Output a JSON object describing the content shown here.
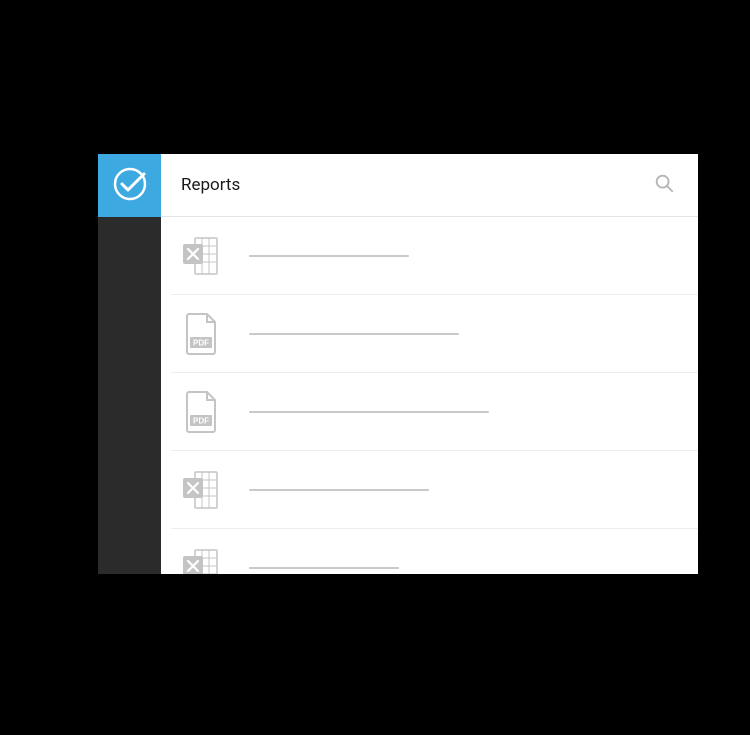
{
  "header": {
    "title": "Reports"
  },
  "icons": {
    "logo": "check-circle",
    "search": "search"
  },
  "list": {
    "items": [
      {
        "type": "excel",
        "placeholder_width": 160
      },
      {
        "type": "pdf",
        "placeholder_width": 210
      },
      {
        "type": "pdf",
        "placeholder_width": 240
      },
      {
        "type": "excel",
        "placeholder_width": 180
      },
      {
        "type": "excel",
        "placeholder_width": 150
      }
    ]
  },
  "colors": {
    "accent": "#3ca9e0",
    "sidebar": "#2b2b2b",
    "icon_muted": "#c4c4c4",
    "divider": "#eeeeee"
  }
}
